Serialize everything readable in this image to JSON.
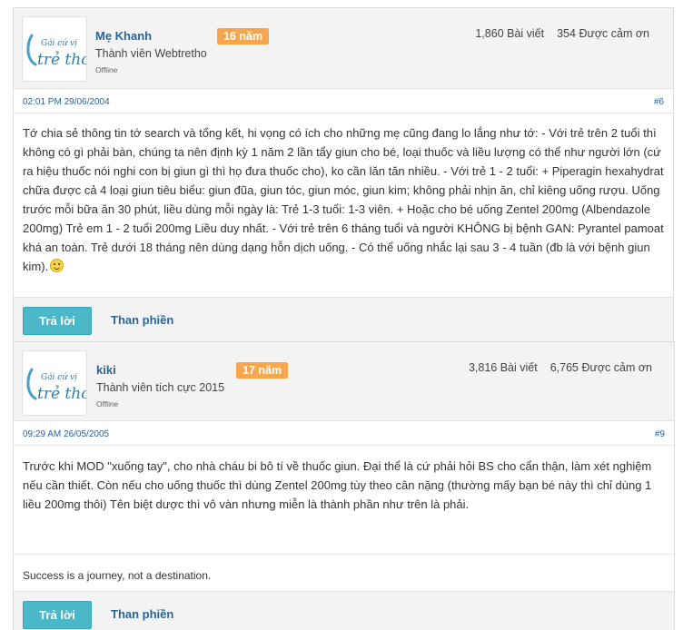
{
  "avatar_logo": {
    "line1": "Gái cứ vị",
    "line2": "trẻ thơ"
  },
  "posts": [
    {
      "username": "Mẹ Khanh",
      "rank": "Thành viên Webtretho",
      "status": "Offline",
      "years": "16 năm",
      "posts_count": "1,860 Bài viết",
      "thanks_count": "354 Được cảm ơn",
      "date": "02:01 PM 29/06/2004",
      "number": "#6",
      "content": "Tớ chia sẻ thông tin tớ search và tổng kết, hi vọng có ích cho những mẹ cũng đang lo lắng như tớ: - Với trẻ trên 2 tuổi thì không có gì phải bàn, chúng ta nên định kỳ 1 năm 2 lần tẩy giun cho bé, loại thuốc và liều lượng có thể như người lớn (cứ ra hiệu thuốc nói nghi con bị giun gì thì họ đưa thuốc cho), ko cần lăn tăn nhiều. - Với trẻ 1 - 2 tuổi: + Piperagin hexahydrat chữa được cả 4 loại giun tiêu biểu: giun đũa, giun tóc, giun móc, giun kim; không phải nhịn ăn, chỉ kiêng uống rượu. Uống trước mỗi bữa ăn 30 phút, liều dùng mỗi ngày là: Trẻ 1-3 tuổi: 1-3 viên. + Hoặc cho bé uống Zentel 200mg (Albendazole 200mg) Trẻ em 1 - 2 tuổi 200mg Liều duy nhất. - Với trẻ trên 6 tháng tuổi và người KHÔNG bị bệnh GAN: Pyrantel pamoat khá an toàn. Trẻ dưới 18 tháng nên dùng dạng hỗn dịch uống. - Có thể uống nhắc lại sau 3 - 4 tuần (đb là với bệnh giun kim).",
      "reply_label": "Trả lời",
      "report_label": "Than phiền"
    },
    {
      "username": "kiki",
      "rank": "Thành viên tích cực 2015",
      "status": "Offline",
      "years": "17 năm",
      "posts_count": "3,816 Bài viết",
      "thanks_count": "6,765 Được cảm ơn",
      "date": "09:29 AM 26/05/2005",
      "number": "#9",
      "content": "Trước khi MOD \"xuống tay\", cho nhà cháu bi bô tí về thuốc giun. Đại thể là cứ phải hỏi BS cho cẩn thận, làm xét nghiệm nếu cần thiết. Còn nếu cho uống thuốc thì dùng Zentel 200mg tùy theo cân nặng (thường mấy bạn bé này thì chỉ dùng 1 liều 200mg thôi) Tên biệt dược thì vô vàn nhưng miễn là thành phần như trên là phải.",
      "signature": "Success is a journey, not a destination.",
      "reply_label": "Trả lời",
      "report_label": "Than phiền"
    }
  ]
}
